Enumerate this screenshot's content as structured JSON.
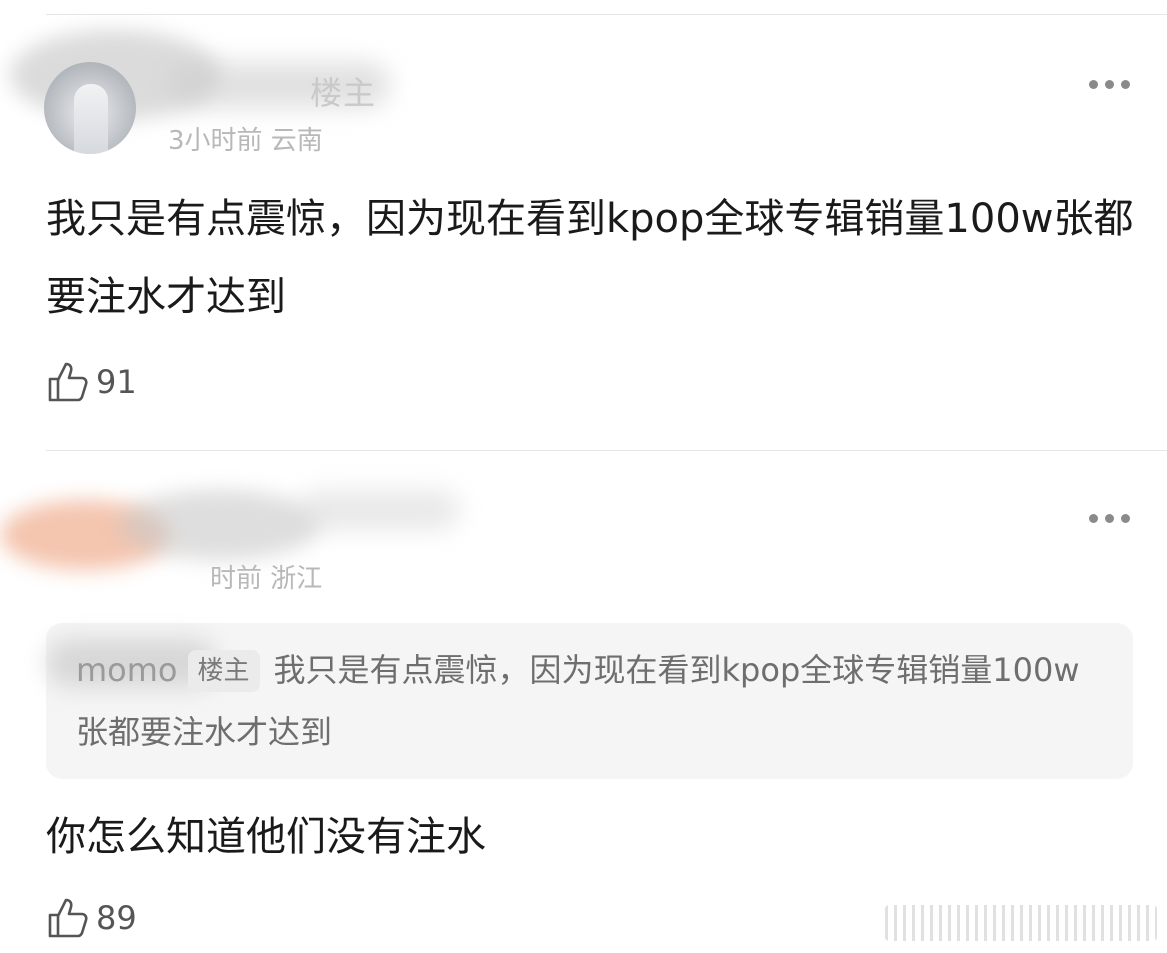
{
  "comments": [
    {
      "username": "楼主",
      "meta": "3小时前 云南",
      "text": "我只是有点震惊，因为现在看到kpop全球专辑销量100w张都要注水才达到",
      "likes": "91"
    },
    {
      "username": "",
      "meta": "时前 浙江",
      "quote": {
        "name": "momo",
        "tag": "楼主",
        "text": "我只是有点震惊，因为现在看到kpop全球专辑销量100w张都要注水才达到"
      },
      "text": "你怎么知道他们没有注水",
      "likes": "89"
    }
  ],
  "icons": {
    "more": "more-dots-icon",
    "like": "thumbs-up-icon"
  },
  "colors": {
    "text": "#1a1a1a",
    "meta": "#b8b8b8",
    "quote_bg": "#f5f5f5"
  }
}
